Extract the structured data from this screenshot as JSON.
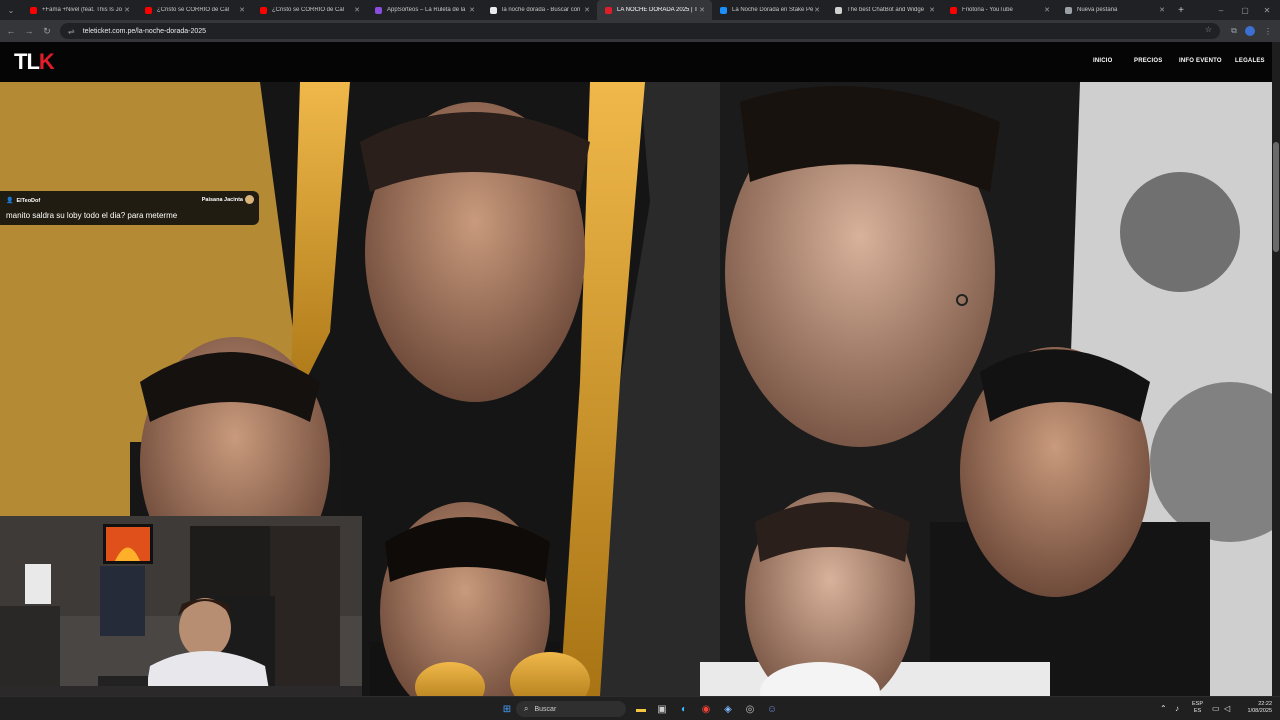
{
  "browser": {
    "tabs": [
      {
        "title": "+Fama +Nivel (feat. This Is Jo",
        "favicon_color": "#ff0000"
      },
      {
        "title": "¿Cristo se CORRIÓ de Cal",
        "favicon_color": "#ff0000"
      },
      {
        "title": "¿Cristo se CORRIÓ de Cal",
        "favicon_color": "#ff0000"
      },
      {
        "title": "AppSorteos – La Ruleta de la",
        "favicon_color": "#8a4de0"
      },
      {
        "title": "la noche dorada - Buscar con",
        "favicon_color": "#e8eaed"
      },
      {
        "title": "LA NOCHE DORADA 2025 | T",
        "favicon_color": "#e11d2a",
        "active": true
      },
      {
        "title": "La Noche Dorada en Stake Pe",
        "favicon_color": "#1a8fff"
      },
      {
        "title": "The best ChatBot and Widge",
        "favicon_color": "#cfcfcf"
      },
      {
        "title": "Friotona - YouTube",
        "favicon_color": "#ff0000"
      },
      {
        "title": "Nueva pestaña",
        "favicon_color": "#9aa0a6"
      }
    ],
    "new_tab_label": "+",
    "url": "teleticket.com.pe/la-noche-dorada-2025"
  },
  "site": {
    "logo_text_main": "TL",
    "logo_text_accent": "K",
    "accent_color": "#e11d2a",
    "nav": [
      "INICIO",
      "PRECIOS",
      "INFO EVENTO",
      "LEGALES"
    ]
  },
  "chat_overlay": {
    "username": "ElTeoDof",
    "reward": "Paisana Jacinta",
    "message": "manito saldra su loby todo el dia? para meterme"
  },
  "taskbar": {
    "search_placeholder": "Buscar",
    "language_top": "ESP",
    "language_bottom": "ES",
    "time": "22:22",
    "date": "1/08/2025"
  }
}
